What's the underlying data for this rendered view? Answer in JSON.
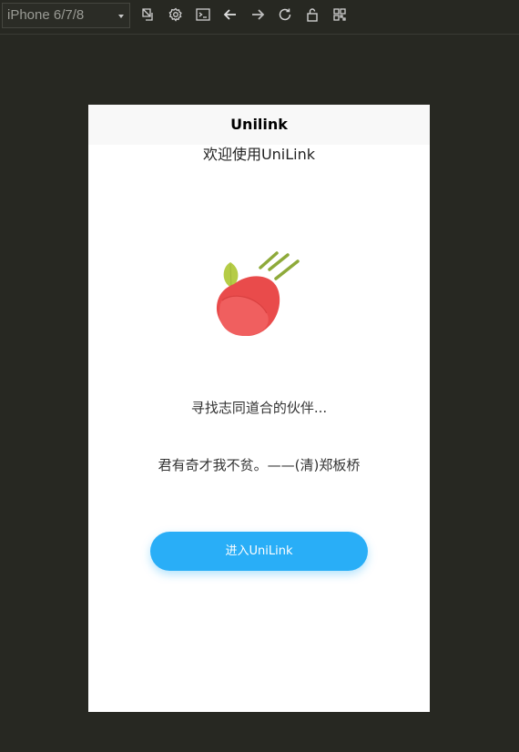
{
  "toolbar": {
    "device": "iPhone 6/7/8",
    "tools": [
      "rotate-icon",
      "settings-icon",
      "console-icon",
      "back-arrow-icon",
      "forward-arrow-icon",
      "refresh-icon",
      "unlock-icon",
      "qrcode-icon"
    ]
  },
  "page": {
    "nav_title": "Unilink",
    "welcome": "欢迎使用UniLink",
    "slogan": "寻找志同道合的伙伴...",
    "quote": "君有奇才我不贫。——(清)郑板桥",
    "enter_button": "进入UniLink"
  },
  "colors": {
    "accent": "#29aef7",
    "apple": "#e94b4b",
    "leaf": "#b5cc46",
    "motion_lines": "#8eaa3a"
  }
}
